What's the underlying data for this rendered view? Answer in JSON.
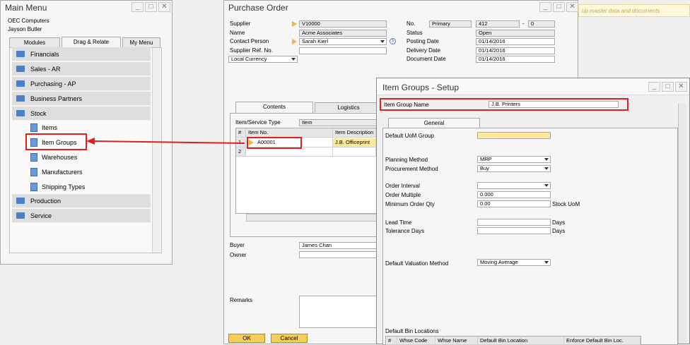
{
  "main_menu": {
    "title": "Main Menu",
    "company": "OEC Computers",
    "user": "Jayson Butler",
    "tabs": [
      "Modules",
      "Drag & Relate",
      "My Menu"
    ],
    "items": [
      {
        "label": "Financials"
      },
      {
        "label": "Sales - AR"
      },
      {
        "label": "Purchasing - AP"
      },
      {
        "label": "Business Partners"
      },
      {
        "label": "Stock"
      }
    ],
    "stock_children": [
      "Items",
      "Item Groups",
      "Warehouses",
      "Manufacturers",
      "Shipping Types"
    ],
    "items_after": [
      {
        "label": "Production"
      },
      {
        "label": "Service"
      }
    ]
  },
  "top_hint": "up master data and documents",
  "purchase_order": {
    "title": "Purchase Order",
    "labels": {
      "supplier": "Supplier",
      "name": "Name",
      "contact_person": "Contact Person",
      "supplier_ref": "Supplier Ref. No.",
      "no": "No.",
      "status": "Status",
      "posting_date": "Posting Date",
      "delivery_date": "Delivery Date",
      "document_date": "Document Date",
      "item_service_type": "Item/Service Type",
      "buyer": "Buyer",
      "owner": "Owner",
      "remarks": "Remarks"
    },
    "values": {
      "supplier": "V10000",
      "name": "Acme Associates",
      "contact_person": "Sarah Kierl",
      "supplier_ref": "",
      "currency": "Local Currency",
      "series": "Primary",
      "doc_no": "412",
      "dash": "-",
      "doc_sub": "0",
      "status": "Open",
      "posting_date": "01/14/2016",
      "delivery_date": "01/14/2016",
      "document_date": "01/14/2016",
      "item_service_type": "Item",
      "buyer": "James Chan"
    },
    "tabs": [
      "Contents",
      "Logistics"
    ],
    "grid": {
      "columns": [
        "#",
        "Item No.",
        "Item Description"
      ],
      "rows": [
        {
          "num": "1",
          "item_no": "A00001",
          "desc": "J.B. Officeprint"
        },
        {
          "num": "2",
          "item_no": "",
          "desc": ""
        }
      ]
    },
    "ok_label": "OK",
    "cancel_label": "Cancel"
  },
  "item_groups": {
    "title": "Item Groups - Setup",
    "group_name_label": "Item Group Name",
    "group_name_value": "J.B. Printers",
    "tab": "General",
    "fields": [
      {
        "label": "Default UoM Group",
        "value": ""
      },
      {
        "label": "Planning Method",
        "value": "MRP"
      },
      {
        "label": "Procurement Method",
        "value": "Buy"
      },
      {
        "label": "Order Interval",
        "value": ""
      },
      {
        "label": "Order Multiple",
        "value": "0.000"
      },
      {
        "label": "Minimum Order Qty",
        "value": "0.00"
      },
      {
        "label": "Lead Time",
        "value": ""
      },
      {
        "label": "Tolerance Days",
        "value": ""
      },
      {
        "label": "Default Valuation Method",
        "value": "Moving Average"
      }
    ],
    "stock_uom": "Stock UoM",
    "days1": "Days",
    "days2": "Days",
    "bin_locations_label": "Default Bin Locations",
    "bin_columns": [
      "#",
      "Whse Code",
      "Whse Name",
      "Default Bin Location",
      "Enforce Default Bin Loc."
    ]
  },
  "colors": {
    "highlight_red": "#e02020",
    "arrow_yellow": "#f2b630",
    "button_yellow": "#f7cd5a",
    "selected_field": "#fbe9a0"
  }
}
